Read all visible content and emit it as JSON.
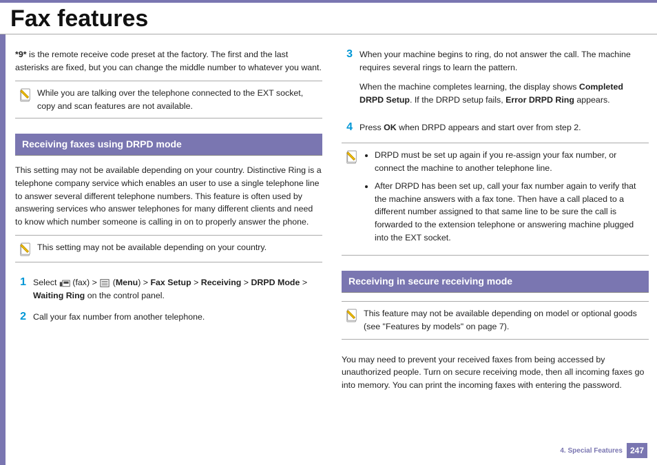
{
  "header": {
    "title": "Fax features"
  },
  "left": {
    "intro_preset": "*9*",
    "intro_rest": " is the remote receive code preset at the factory. The first and the last asterisks are fixed, but you can change the middle number to whatever you want.",
    "note1": "While you are talking over the telephone connected to the EXT socket, copy and scan features are not available.",
    "section1": "Receiving faxes using DRPD mode",
    "section1_para": "This setting may not be available depending on your country. Distinctive Ring is a telephone company service which enables an user to use a single telephone line to answer several different telephone numbers. This feature is often used by answering services who answer telephones for many different clients and need to know which number someone is calling in on to properly answer the phone.",
    "note2": "This setting may not be available depending on your country.",
    "step1": {
      "num": "1",
      "pre": "Select ",
      "fax_label": " (fax) > ",
      "menu_open": "(",
      "menu": "Menu",
      "menu_close": ") > ",
      "path1": "Fax Setup",
      "path_sep1": " > ",
      "path2": "Receiving",
      "path_sep2": " > ",
      "path3": "DRPD Mode",
      "path_sep3": " > ",
      "path4": "Waiting Ring",
      "suffix": " on the control panel."
    },
    "step2": {
      "num": "2",
      "text": "Call your fax number from another telephone."
    }
  },
  "right": {
    "step3": {
      "num": "3",
      "line1": "When your machine begins to ring, do not answer the call. The machine requires several rings to learn the pattern.",
      "line2_a": "When the machine completes learning, the display shows ",
      "line2_b": "Completed DRPD Setup",
      "line2_c": ". If the DRPD setup fails, ",
      "line2_d": "Error DRPD Ring",
      "line2_e": " appears."
    },
    "step4": {
      "num": "4",
      "pre": "Press ",
      "ok": "OK",
      "post": " when DRPD appears and start over from step 2."
    },
    "note3_item1": "DRPD must be set up again if you re-assign your fax number, or connect the machine to another telephone line.",
    "note3_item2": "After DRPD has been set up, call your fax number again to verify that the machine answers with a fax tone. Then have a call placed to a different number assigned to that same line to be sure the call is forwarded to the extension telephone or answering machine plugged into the EXT socket.",
    "section2": "Receiving in secure receiving mode",
    "note4": "This feature may not be available depending on model or optional goods (see \"Features by models\" on page 7).",
    "section2_para": "You may need to prevent your received faxes from being accessed by unauthorized people. Turn on secure receiving mode, then all incoming faxes go into memory. You can print the incoming faxes with entering the password."
  },
  "footer": {
    "chapter": "4.  Special Features",
    "page": "247"
  }
}
